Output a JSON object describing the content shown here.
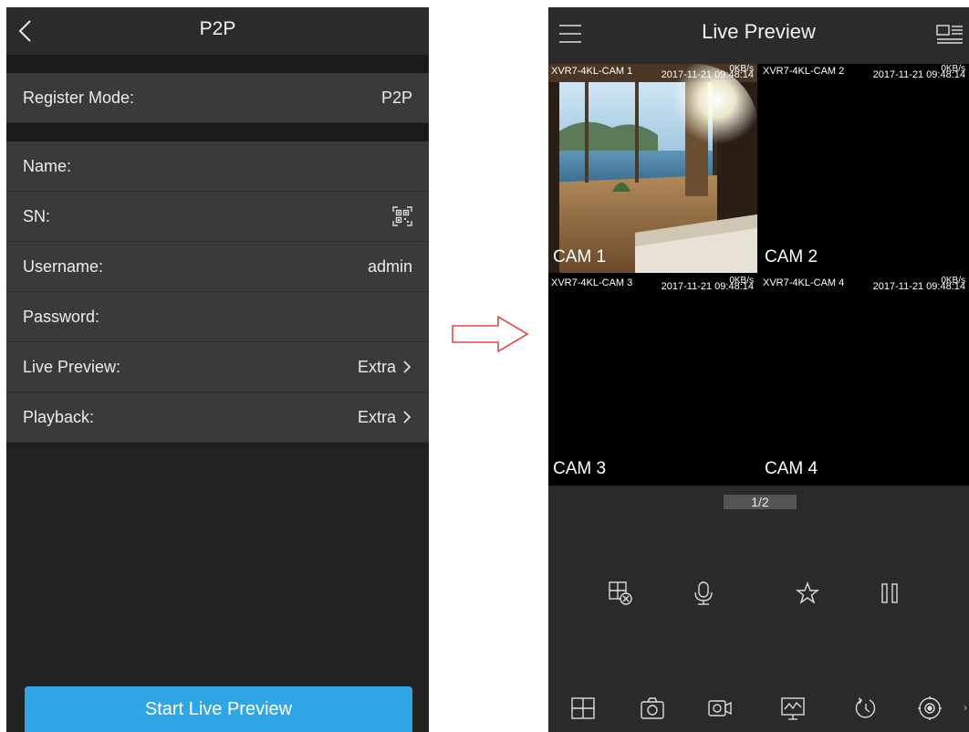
{
  "left": {
    "title": "P2P",
    "rows": [
      {
        "label": "Register Mode:",
        "value": "P2P"
      },
      {
        "label": "Name:",
        "value": ""
      },
      {
        "label": "SN:",
        "value": ""
      },
      {
        "label": "Username:",
        "value": "admin"
      },
      {
        "label": "Password:",
        "value": ""
      },
      {
        "label": "Live Preview:",
        "value": "Extra"
      },
      {
        "label": "Playback:",
        "value": "Extra"
      }
    ],
    "start_button": "Start Live Preview",
    "accent": "#2fa7e6"
  },
  "right": {
    "title": "Live Preview",
    "tiles": [
      {
        "name": "XVR7-4KL-CAM 1",
        "timestamp": "2017-11-21 09:48:14",
        "rate": "0KB/s",
        "label": "CAM 1"
      },
      {
        "name": "XVR7-4KL-CAM 2",
        "timestamp": "2017-11-21 09:48:14",
        "rate": "0KB/s",
        "label": "CAM 2"
      },
      {
        "name": "XVR7-4KL-CAM 3",
        "timestamp": "2017-11-21 09:48:14",
        "rate": "0KB/s",
        "label": "CAM 3"
      },
      {
        "name": "XVR7-4KL-CAM 4",
        "timestamp": "2017-11-21 09:48:14",
        "rate": "0KB/s",
        "label": "CAM 4"
      }
    ],
    "page_indicator": "1/2",
    "controls": [
      "close-window-icon",
      "microphone-icon",
      "favorite-star-icon",
      "pause-icon"
    ],
    "toolbar": [
      "split-screen-icon",
      "snapshot-icon",
      "record-icon",
      "alarm-screen-icon",
      "playback-history-icon",
      "ptz-icon"
    ],
    "selection_color": "#5fb3d9"
  }
}
